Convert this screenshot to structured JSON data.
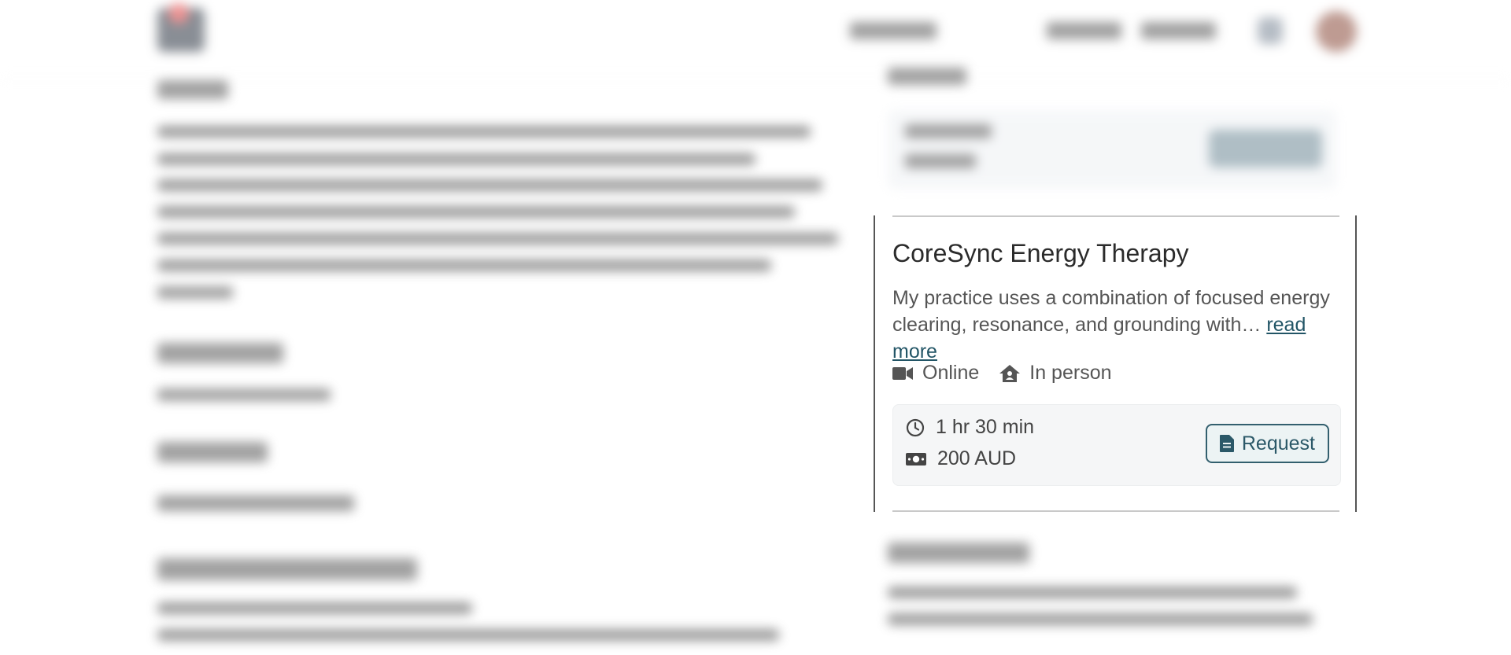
{
  "card": {
    "title": "CoreSync Energy Therapy",
    "description": "My practice uses a combination of focused energy clearing, resonance, and grounding with…",
    "read_more": "read more",
    "modes": [
      {
        "label": "Online",
        "icon": "video-camera-icon"
      },
      {
        "label": "In person",
        "icon": "house-icon"
      }
    ],
    "duration": "1 hr 30 min",
    "price": "200 AUD",
    "request_label": "Request"
  },
  "colors": {
    "accent": "#335f6e",
    "info_bg": "#f5f6f7",
    "link": "#225566"
  }
}
